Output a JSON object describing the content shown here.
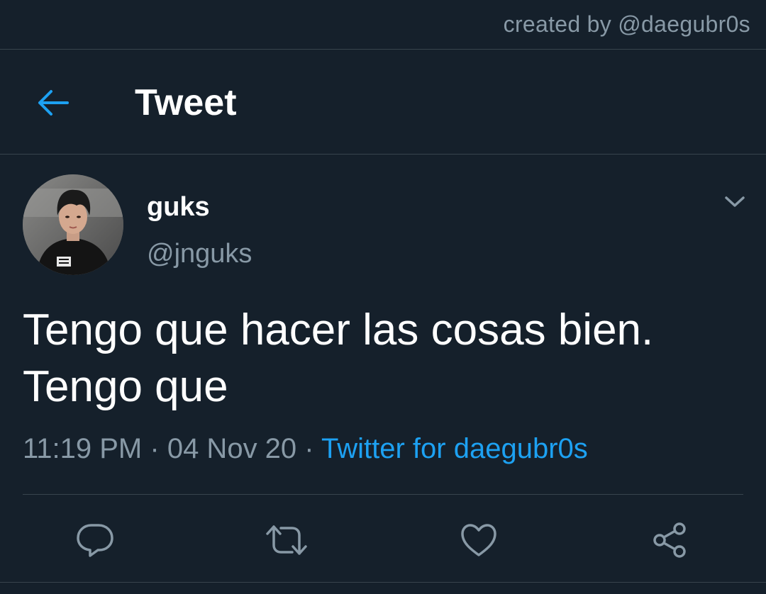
{
  "credit": "created by @daegubr0s",
  "header": {
    "title": "Tweet",
    "back_icon": "back-arrow-icon"
  },
  "tweet": {
    "author": {
      "name": "guks",
      "handle": "@jnguks"
    },
    "text_line1": "Tengo que hacer las cosas bien.",
    "text_line2": "Tengo que",
    "time": "11:19 PM",
    "date": "04 Nov 20",
    "separator": "·",
    "source": "Twitter for daegubr0s"
  },
  "actions": [
    "reply-icon",
    "retweet-icon",
    "like-icon",
    "share-icon"
  ],
  "colors": {
    "background": "#15202b",
    "divider": "#38444d",
    "accent": "#1da1f2",
    "secondary_text": "#8899a6",
    "primary_text": "#ffffff"
  }
}
